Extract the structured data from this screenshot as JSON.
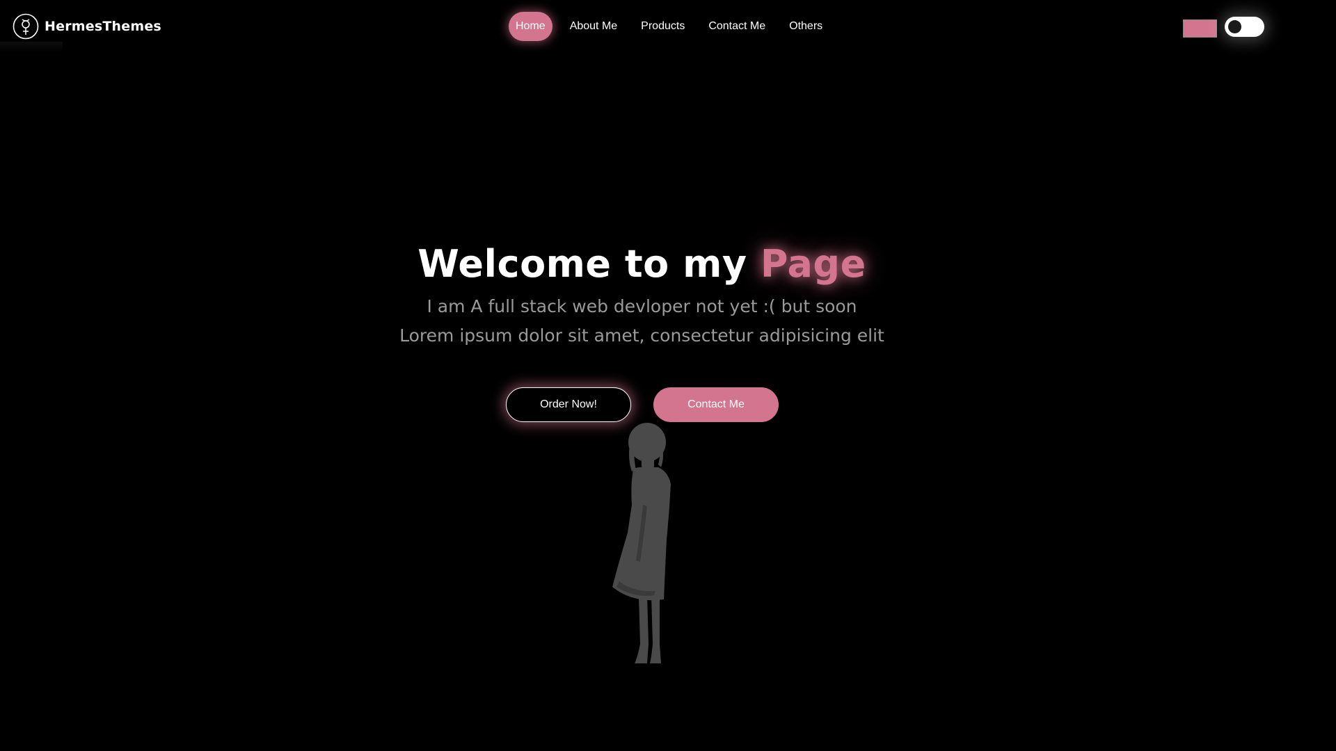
{
  "brand": {
    "name": "HermesThemes",
    "logo_icon": "venus-mercury-symbol-icon"
  },
  "nav": {
    "items": [
      {
        "label": "Home",
        "active": true
      },
      {
        "label": "About Me",
        "active": false
      },
      {
        "label": "Products",
        "active": false
      },
      {
        "label": "Contact Me",
        "active": false
      },
      {
        "label": "Others",
        "active": false
      }
    ]
  },
  "controls": {
    "accent_color": "#d4758f",
    "theme_toggle_icon": "dark-mode-toggle-icon"
  },
  "hero": {
    "title_prefix": "Welcome to my ",
    "title_accent": "Page",
    "subtitle_line1": "I am A full stack web devloper not yet :( but soon",
    "subtitle_line2": "Lorem ipsum dolor sit amet, consectetur adipisicing elit",
    "primary_button": "Order Now!",
    "secondary_button": "Contact Me",
    "illustration_icon": "girl-silhouette-illustration"
  },
  "colors": {
    "background": "#000000",
    "accent": "#d4758f",
    "text": "#ffffff",
    "muted_text": "#9a9a9a"
  }
}
